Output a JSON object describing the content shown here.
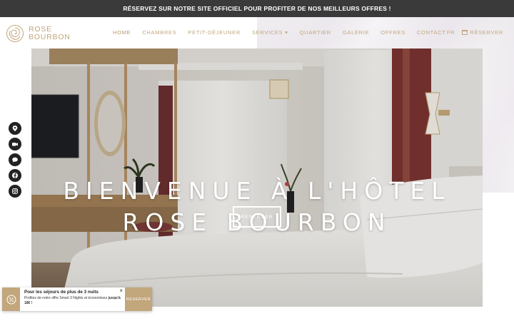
{
  "topbar": {
    "text": "RÉSERVEZ SUR NOTRE SITE OFFICIEL POUR PROFITER DE NOS MEILLEURS OFFRES !"
  },
  "logo": {
    "line1": "ROSE",
    "line2": "BOURBON"
  },
  "nav": {
    "items": [
      {
        "label": "HOME"
      },
      {
        "label": "CHAMBRES"
      },
      {
        "label": "PETIT-DÉJEUNER"
      },
      {
        "label": "SERVICES ▾"
      },
      {
        "label": "QUARTIER"
      },
      {
        "label": "GALERIE"
      },
      {
        "label": "OFFRES"
      },
      {
        "label": "CONTACT"
      }
    ],
    "language": "FR",
    "reserve": "RÉSERVER"
  },
  "hero": {
    "title_line1": "BIENVENUE À L'HÔTEL",
    "title_line2": "ROSE BOURBON",
    "button": "RESERVER"
  },
  "social": [
    "map-pin-icon",
    "video-icon",
    "chat-icon",
    "facebook-icon",
    "instagram-icon"
  ],
  "promo": {
    "title": "Pour les séjours de plus de 3 nuits",
    "body_prefix": "Profitez de notre offre Smart 3 Nights et économisez ",
    "body_bold": "jusqu'à 18€ !",
    "close": "×",
    "button": "RESERVER"
  },
  "colors": {
    "accent": "#c2a67c",
    "topbar": "#3a3a3a"
  }
}
